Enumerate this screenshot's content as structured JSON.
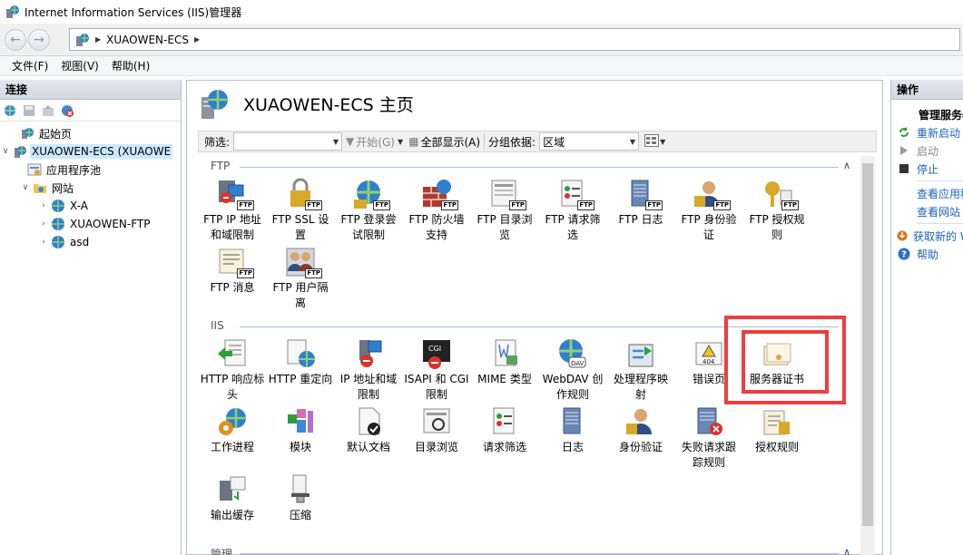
{
  "window": {
    "title": "Internet Information Services (IIS)管理器"
  },
  "address": {
    "segments": [
      "XUAOWEN-ECS"
    ]
  },
  "menu": {
    "items": [
      "文件(F)",
      "视图(V)",
      "帮助(H)"
    ]
  },
  "left_panel": {
    "header": "连接",
    "tree": {
      "start": "起始页",
      "server": "XUAOWEN-ECS (XUAOWE",
      "app_pools": "应用程序池",
      "sites": "网站",
      "site_items": [
        "X-A",
        "XUAOWEN-FTP",
        "asd"
      ]
    }
  },
  "center": {
    "title": "XUAOWEN-ECS 主页",
    "filter": {
      "label": "筛选:",
      "start_label": "开始(G)",
      "show_all_label": "全部显示(A)",
      "group_label": "分组依据:",
      "group_value": "区域"
    },
    "sections": {
      "ftp": "FTP",
      "iis": "IIS",
      "management": "管理"
    },
    "ftp_features": [
      [
        "FTP IP 地址",
        "和域限制"
      ],
      [
        "FTP SSL 设",
        "置"
      ],
      [
        "FTP 登录尝",
        "试限制"
      ],
      [
        "FTP 防火墙",
        "支持"
      ],
      [
        "FTP 目录浏",
        "览"
      ],
      [
        "FTP 请求筛",
        "选"
      ],
      [
        "FTP 日志",
        ""
      ],
      [
        "FTP 身份验",
        "证"
      ],
      [
        "FTP 授权规",
        "则"
      ],
      [
        "FTP 消息",
        ""
      ],
      [
        "FTP 用户隔",
        "离"
      ]
    ],
    "iis_features": [
      [
        "HTTP 响应标",
        "头"
      ],
      [
        "HTTP 重定向",
        ""
      ],
      [
        "IP 地址和域",
        "限制"
      ],
      [
        "ISAPI 和 CGI",
        "限制"
      ],
      [
        "MIME 类型",
        ""
      ],
      [
        "WebDAV 创",
        "作规则"
      ],
      [
        "处理程序映",
        "射"
      ],
      [
        "错误页",
        ""
      ],
      [
        "服务器证书",
        ""
      ],
      [
        "工作进程",
        ""
      ],
      [
        "模块",
        ""
      ],
      [
        "默认文档",
        ""
      ],
      [
        "目录浏览",
        ""
      ],
      [
        "请求筛选",
        ""
      ],
      [
        "日志",
        ""
      ],
      [
        "身份验证",
        ""
      ],
      [
        "失败请求跟",
        "踪规则"
      ],
      [
        "授权规则",
        ""
      ],
      [
        "输出缓存",
        ""
      ],
      [
        "压缩",
        ""
      ]
    ]
  },
  "right_panel": {
    "header": "操作",
    "group_title": "管理服务器",
    "actions": {
      "restart": "重新启动",
      "start": "启动",
      "stop": "停止",
      "view_apps": "查看应用程序池",
      "view_sites": "查看网站",
      "get_new": "获取新的 Web 平台组件",
      "help": "帮助"
    }
  },
  "colors": {
    "highlight": "#f03d3d",
    "link": "#1c62b9",
    "selection": "#cce8ff"
  }
}
